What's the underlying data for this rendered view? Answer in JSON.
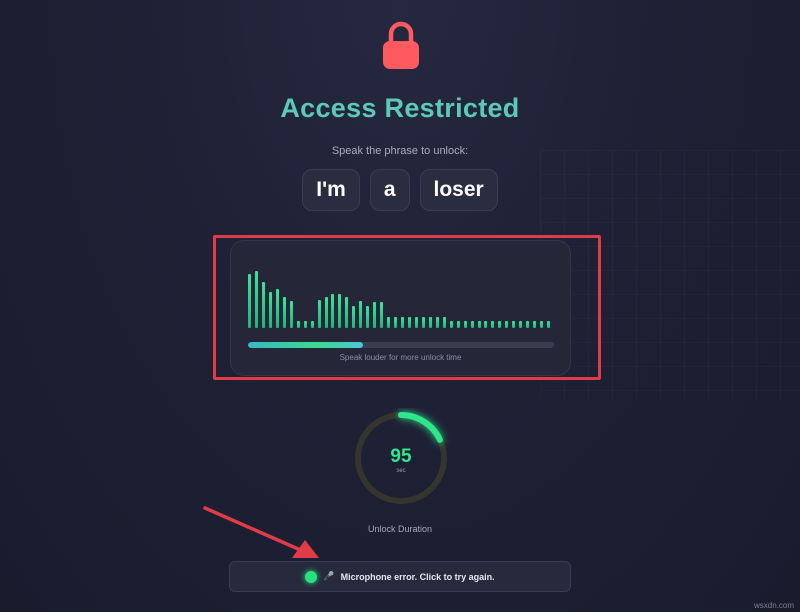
{
  "header": {
    "title": "Access Restricted",
    "instruction": "Speak the phrase to unlock:"
  },
  "phrase": {
    "words": [
      "I'm",
      "a",
      "loser"
    ]
  },
  "visualizer": {
    "levels": [
      0.95,
      1.0,
      0.8,
      0.63,
      0.68,
      0.55,
      0.48,
      0.12,
      0.12,
      0.12,
      0.5,
      0.55,
      0.6,
      0.6,
      0.55,
      0.38,
      0.48,
      0.38,
      0.45,
      0.45,
      0.2,
      0.2,
      0.2,
      0.2,
      0.2,
      0.2,
      0.2,
      0.2,
      0.2,
      0.12,
      0.12,
      0.12,
      0.12,
      0.12,
      0.12,
      0.12,
      0.12,
      0.12,
      0.12,
      0.12,
      0.12,
      0.12,
      0.12,
      0.12
    ],
    "progress": 0.375,
    "hint": "Speak louder for more unlock time"
  },
  "timer": {
    "value": "95",
    "unit": "sec",
    "fraction": 0.18,
    "label": "Unlock Duration"
  },
  "status": {
    "icon": "microphone-icon",
    "message": "Microphone error. Click to try again.",
    "dot_color": "#27e07e"
  },
  "watermark": "wsxdn.com",
  "colors": {
    "accent": "#5cc9ba",
    "lock": "#ff5a5f",
    "timer": "#2ee68c",
    "highlight": "#e23b48"
  }
}
